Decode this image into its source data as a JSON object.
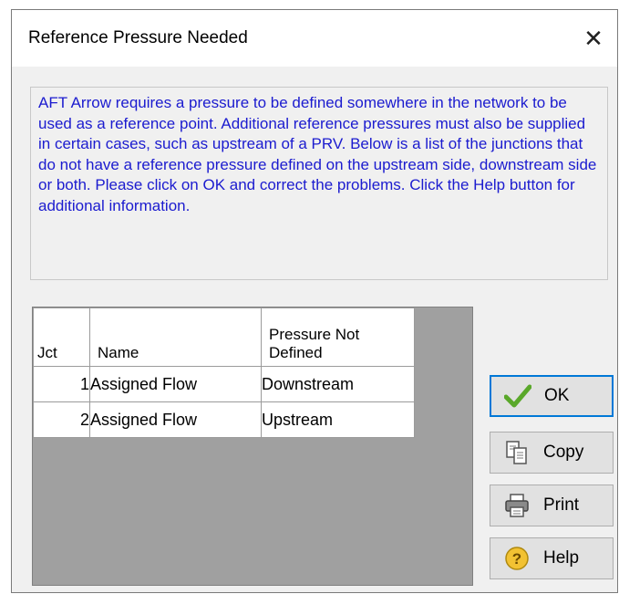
{
  "dialog": {
    "title": "Reference Pressure Needed",
    "close_glyph": "✕"
  },
  "info": {
    "text": "AFT Arrow requires a pressure to be defined somewhere in the network to be used as a reference point.  Additional reference pressures must also be supplied in certain cases, such as upstream of a PRV.  Below is a list of the junctions that do not have a reference pressure defined on the upstream side, downstream side or both.  Please click on OK and correct the problems.  Click the Help button for additional information."
  },
  "grid": {
    "headers": [
      "Jct",
      "Name",
      "Pressure Not Defined"
    ],
    "rows": [
      {
        "jct": "1",
        "name": "Assigned Flow",
        "pressure": "Downstream"
      },
      {
        "jct": "2",
        "name": "Assigned Flow",
        "pressure": "Upstream"
      }
    ],
    "selected_row": 1
  },
  "buttons": {
    "ok": "OK",
    "copy": "Copy",
    "print": "Print",
    "help": "Help"
  },
  "icons": {
    "ok": "check-icon",
    "copy": "copy-icon",
    "print": "printer-icon",
    "help": "help-icon"
  },
  "colors": {
    "info_text": "#1b1bcf",
    "selection": "#0078d7",
    "grid_background": "#a0a0a0"
  }
}
